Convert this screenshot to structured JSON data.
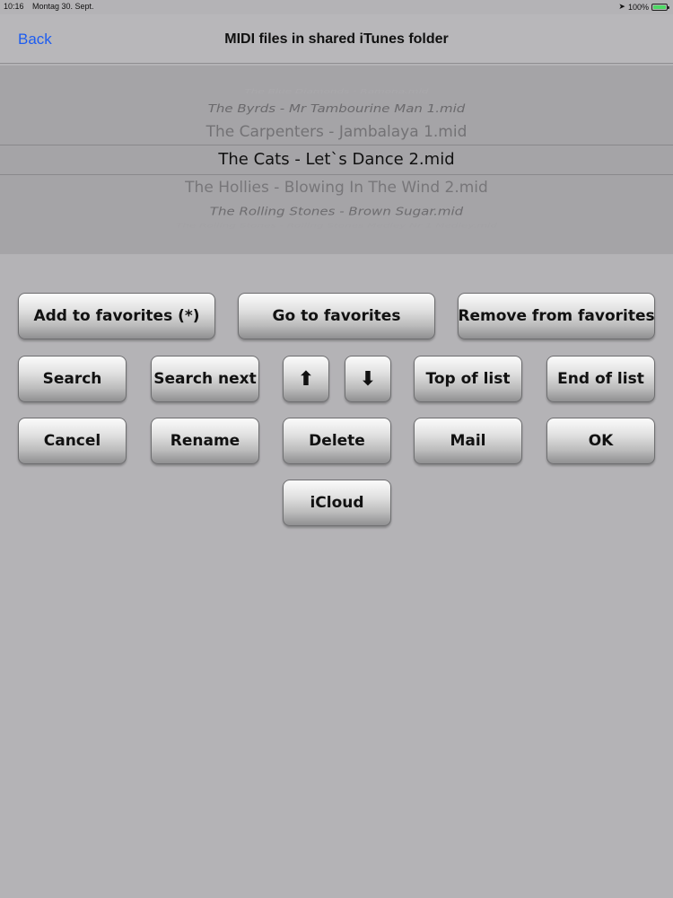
{
  "status": {
    "time": "10:16",
    "date": "Montag 30. Sept.",
    "battery": "100%"
  },
  "nav": {
    "back_label": "Back",
    "title": "MIDI files in shared iTunes folder"
  },
  "picker": {
    "items": [
      "The Blue Diamonds - Ramona.mid",
      "The Byrds - Mr Tambourine Man 1.mid",
      "The Carpenters - Jambalaya 1.mid",
      "The Cats - Let`s Dance 2.mid",
      "The Hollies - Blowing In The Wind 2.mid",
      "The Rolling Stones - Brown Sugar.mid",
      "The Rolling Stones - Rolling Stones Medley Nr 1 Medley.mid"
    ],
    "selected_index": 3
  },
  "buttons": {
    "add_favorites": "Add to favorites (*)",
    "go_favorites": "Go to favorites",
    "remove_favorites": "Remove from favorites",
    "search": "Search",
    "search_next": "Search next",
    "arrow_up": "⬆",
    "arrow_down": "⬇",
    "top_of_list": "Top of list",
    "end_of_list": "End of list",
    "cancel": "Cancel",
    "rename": "Rename",
    "delete": "Delete",
    "mail": "Mail",
    "ok": "OK",
    "icloud": "iCloud"
  },
  "colors": {
    "background": "#b4b3b6",
    "link": "#1d5cf0",
    "battery": "#4cd964"
  }
}
